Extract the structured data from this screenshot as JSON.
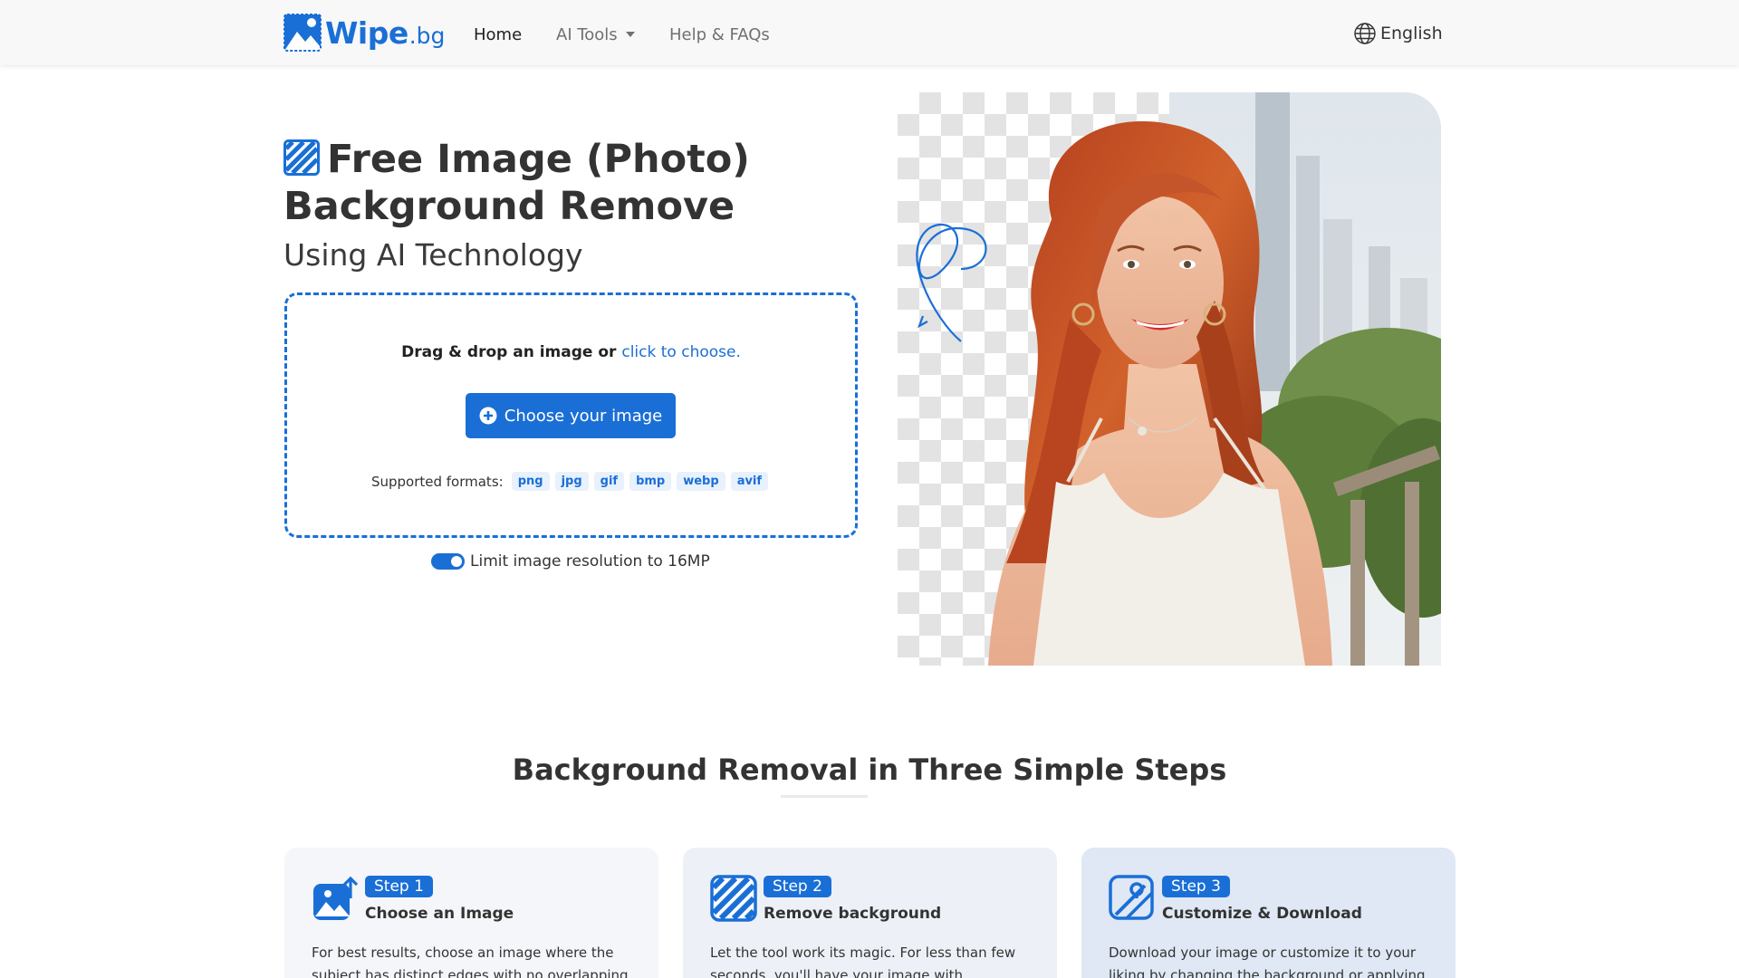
{
  "nav": {
    "brand_name": "Wipe",
    "brand_tld": ".bg",
    "links": [
      {
        "label": "Home",
        "active": true
      },
      {
        "label": "AI Tools",
        "dropdown": true
      },
      {
        "label": "Help & FAQs"
      }
    ],
    "language": "English",
    "language_icon": "globe-icon"
  },
  "hero": {
    "title_icon": "checkered-image-icon",
    "title": "Free Image (Photo) Background Remove",
    "subtitle": "Using AI Technology",
    "dropzone": {
      "prompt": "Drag & drop an image or",
      "link": "click to choose.",
      "button_label": "Choose your image",
      "button_icon": "plus-circle-icon",
      "formats_label": "Supported formats:",
      "formats": [
        "png",
        "jpg",
        "gif",
        "bmp",
        "webp",
        "avif"
      ]
    },
    "limit_toggle": {
      "label": "Limit image resolution to 16MP",
      "checked": true
    }
  },
  "steps": {
    "title": "Background Removal in Three Simple Steps",
    "items": [
      {
        "badge": "Step 1",
        "title": "Choose an Image",
        "icon": "image-upload-icon",
        "text": "For best results, choose an image where the subject has distinct edges with no overlapping"
      },
      {
        "badge": "Step 2",
        "title": "Remove background",
        "icon": "checkered-image-icon",
        "text": "Let the tool work its magic. For less than few seconds, you'll have your image with"
      },
      {
        "badge": "Step 3",
        "title": "Customize & Download",
        "icon": "edit-image-icon",
        "text": "Download your image or customize it to your liking by changing the background or applying"
      }
    ]
  },
  "colors": {
    "accent": "#1a6fd6",
    "navbar_bg": "#f8f8f8",
    "format_chip_bg": "#e8f1fc"
  }
}
